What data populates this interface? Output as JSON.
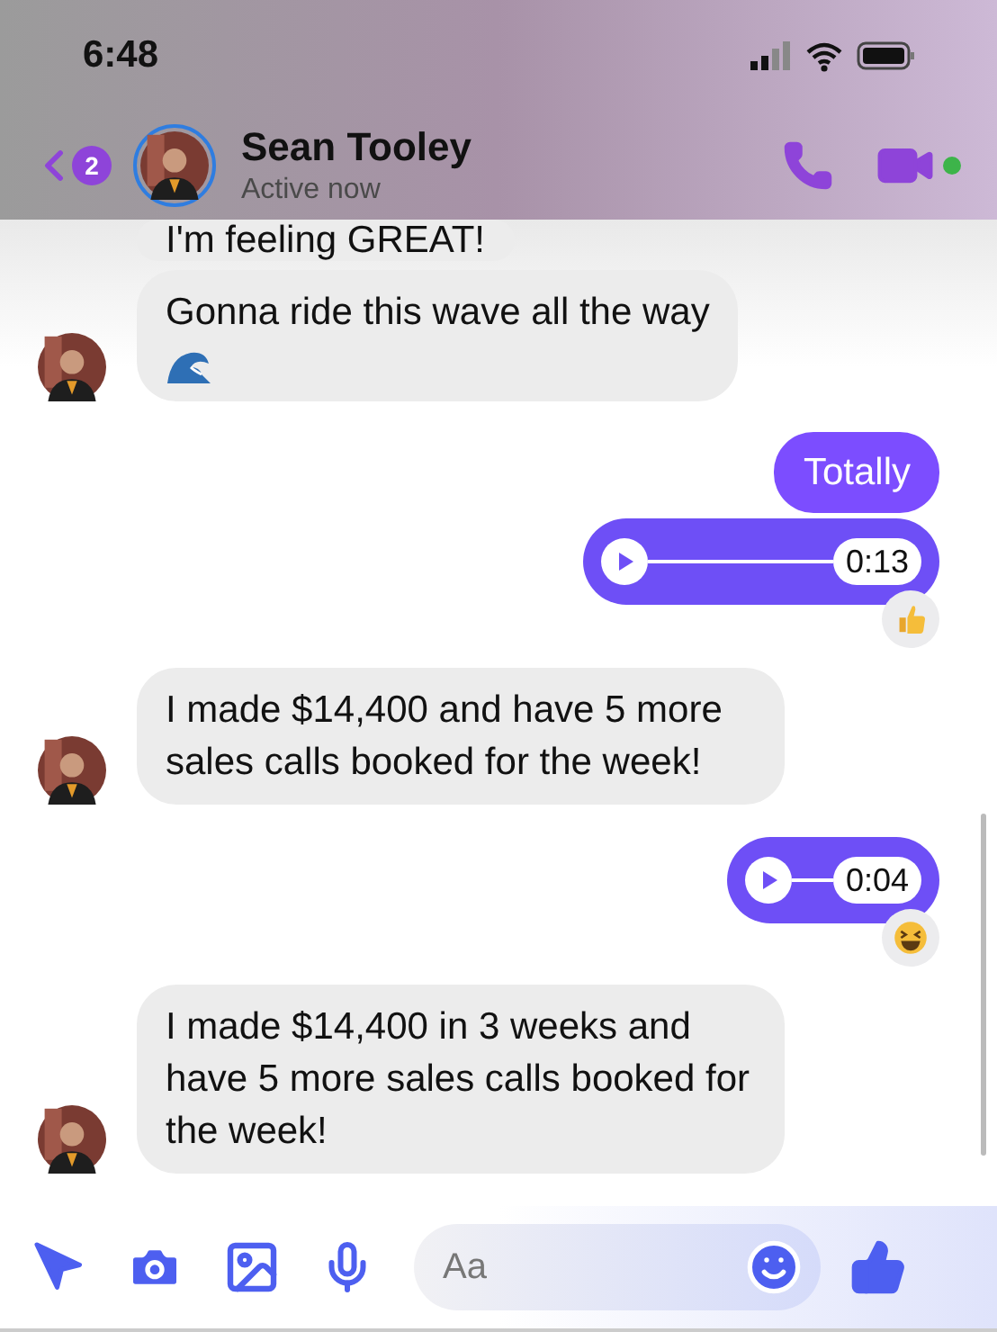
{
  "status_bar": {
    "time": "6:48"
  },
  "header": {
    "back_badge": "2",
    "name": "Sean Tooley",
    "status": "Active now",
    "online": true
  },
  "messages": [
    {
      "kind": "received_text",
      "text": "I'm feeling GREAT!",
      "avatar": false
    },
    {
      "kind": "received_text",
      "text": "Gonna ride this wave all the way",
      "wave": true,
      "avatar": true
    },
    {
      "kind": "sent_text",
      "text": "Totally"
    },
    {
      "kind": "sent_audio",
      "duration": "0:13",
      "reaction": {
        "kind": "thumbs_up"
      },
      "wide": true
    },
    {
      "kind": "received_text",
      "text": "I made $14,400 and have 5 more sales calls booked for the week!",
      "avatar": true
    },
    {
      "kind": "sent_audio",
      "duration": "0:04",
      "reaction": {
        "kind": "laugh"
      },
      "wide": false
    },
    {
      "kind": "received_text",
      "text": "I made $14,400 in 3 weeks and have 5 more sales calls booked for the week!",
      "avatar": true
    }
  ],
  "composer": {
    "placeholder": "Aa"
  }
}
